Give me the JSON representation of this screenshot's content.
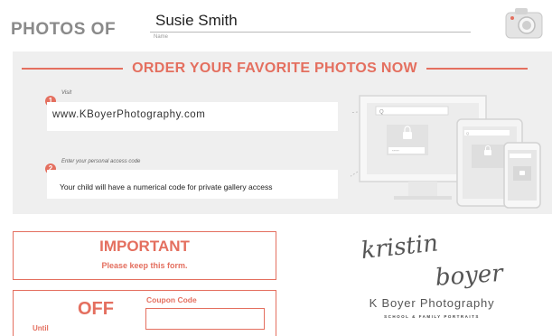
{
  "header": {
    "title": "PHOTOS OF",
    "name_value": "Susie Smith",
    "name_label": "Name",
    "camera_icon": "camera-icon"
  },
  "order": {
    "title": "ORDER YOUR FAVORITE PHOTOS NOW",
    "steps": [
      {
        "number": "1",
        "label": "Visit",
        "value": "www.KBoyerPhotography.com"
      },
      {
        "number": "2",
        "label": "Enter your personal access code",
        "value": "Your child will have a numerical code for private gallery access"
      }
    ],
    "devices_icon": "devices-icon",
    "lock_icon": "lock-icon"
  },
  "important": {
    "title": "IMPORTANT",
    "subtitle": "Please keep this form."
  },
  "coupon": {
    "off_label": "OFF",
    "until_label": "Until",
    "code_label": "Coupon Code",
    "code_value": ""
  },
  "brand": {
    "script_line1": "kristin",
    "script_line2": "boyer",
    "name": "K Boyer Photography",
    "tagline": "SCHOOL & FAMILY PORTRAITS"
  },
  "colors": {
    "accent": "#e46f5f",
    "panel": "#efefef",
    "heading_gray": "#8a8a8a"
  }
}
